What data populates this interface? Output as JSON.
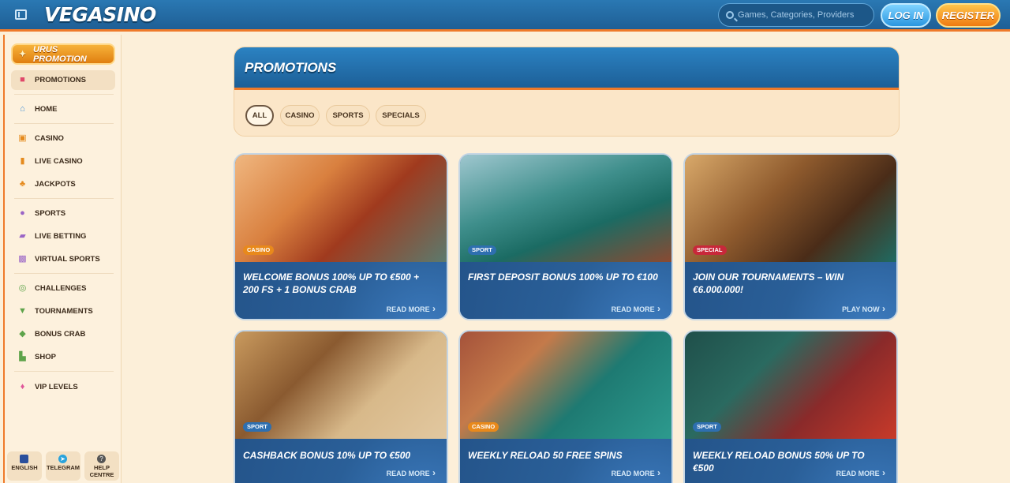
{
  "header": {
    "logo": "VEGASINO",
    "search_placeholder": "Games, Categories, Providers",
    "login_label": "LOG IN",
    "register_label": "REGISTER"
  },
  "sidebar": {
    "bonus_button": "URUS PROMOTION",
    "items": [
      {
        "label": "PROMOTIONS",
        "icon": "gift-icon"
      },
      {
        "label": "HOME",
        "icon": "home-icon"
      },
      {
        "label": "CASINO",
        "icon": "casino-icon"
      },
      {
        "label": "LIVE CASINO",
        "icon": "live-casino-icon"
      },
      {
        "label": "JACKPOTS",
        "icon": "clover-icon"
      },
      {
        "label": "SPORTS",
        "icon": "ball-icon"
      },
      {
        "label": "LIVE BETTING",
        "icon": "live-icon"
      },
      {
        "label": "VIRTUAL SPORTS",
        "icon": "virtual-icon"
      },
      {
        "label": "CHALLENGES",
        "icon": "medal-icon"
      },
      {
        "label": "TOURNAMENTS",
        "icon": "trophy-icon"
      },
      {
        "label": "BONUS CRAB",
        "icon": "crab-icon"
      },
      {
        "label": "SHOP",
        "icon": "basket-icon"
      },
      {
        "label": "VIP LEVELS",
        "icon": "diamond-icon"
      }
    ],
    "footer": [
      {
        "label": "ENGLISH",
        "icon": "flag-icon"
      },
      {
        "label": "TELEGRAM",
        "icon": "telegram-icon"
      },
      {
        "label": "HELP CENTRE",
        "icon": "help-icon"
      }
    ]
  },
  "promotions": {
    "title": "PROMOTIONS",
    "filters": [
      "ALL",
      "CASINO",
      "SPORTS",
      "SPECIALS"
    ],
    "cards": [
      {
        "tag": "CASINO",
        "title": "WELCOME BONUS 100% UP TO €500 + 200 FS + 1 BONUS CRAB",
        "link": "READ MORE"
      },
      {
        "tag": "SPORT",
        "title": "FIRST DEPOSIT BONUS 100% UP TO €100",
        "link": "READ MORE"
      },
      {
        "tag": "SPECIAL",
        "title": "JOIN OUR TOURNAMENTS – WIN €6.000.000!",
        "link": "PLAY NOW"
      },
      {
        "tag": "SPORT",
        "title": "CASHBACK BONUS 10% UP TO €500",
        "link": "READ MORE"
      },
      {
        "tag": "CASINO",
        "title": "WEEKLY RELOAD 50 FREE SPINS",
        "link": "READ MORE"
      },
      {
        "tag": "SPORT",
        "title": "WEEKLY RELOAD BONUS 50% UP TO €500",
        "link": "READ MORE"
      }
    ]
  },
  "colors": {
    "casino_tag": "#e8891b",
    "sport_tag": "#2e6fb0",
    "special_tag": "#c8283a",
    "accent_orange": "#ef7a2a",
    "header_blue": "#1f5f95"
  }
}
